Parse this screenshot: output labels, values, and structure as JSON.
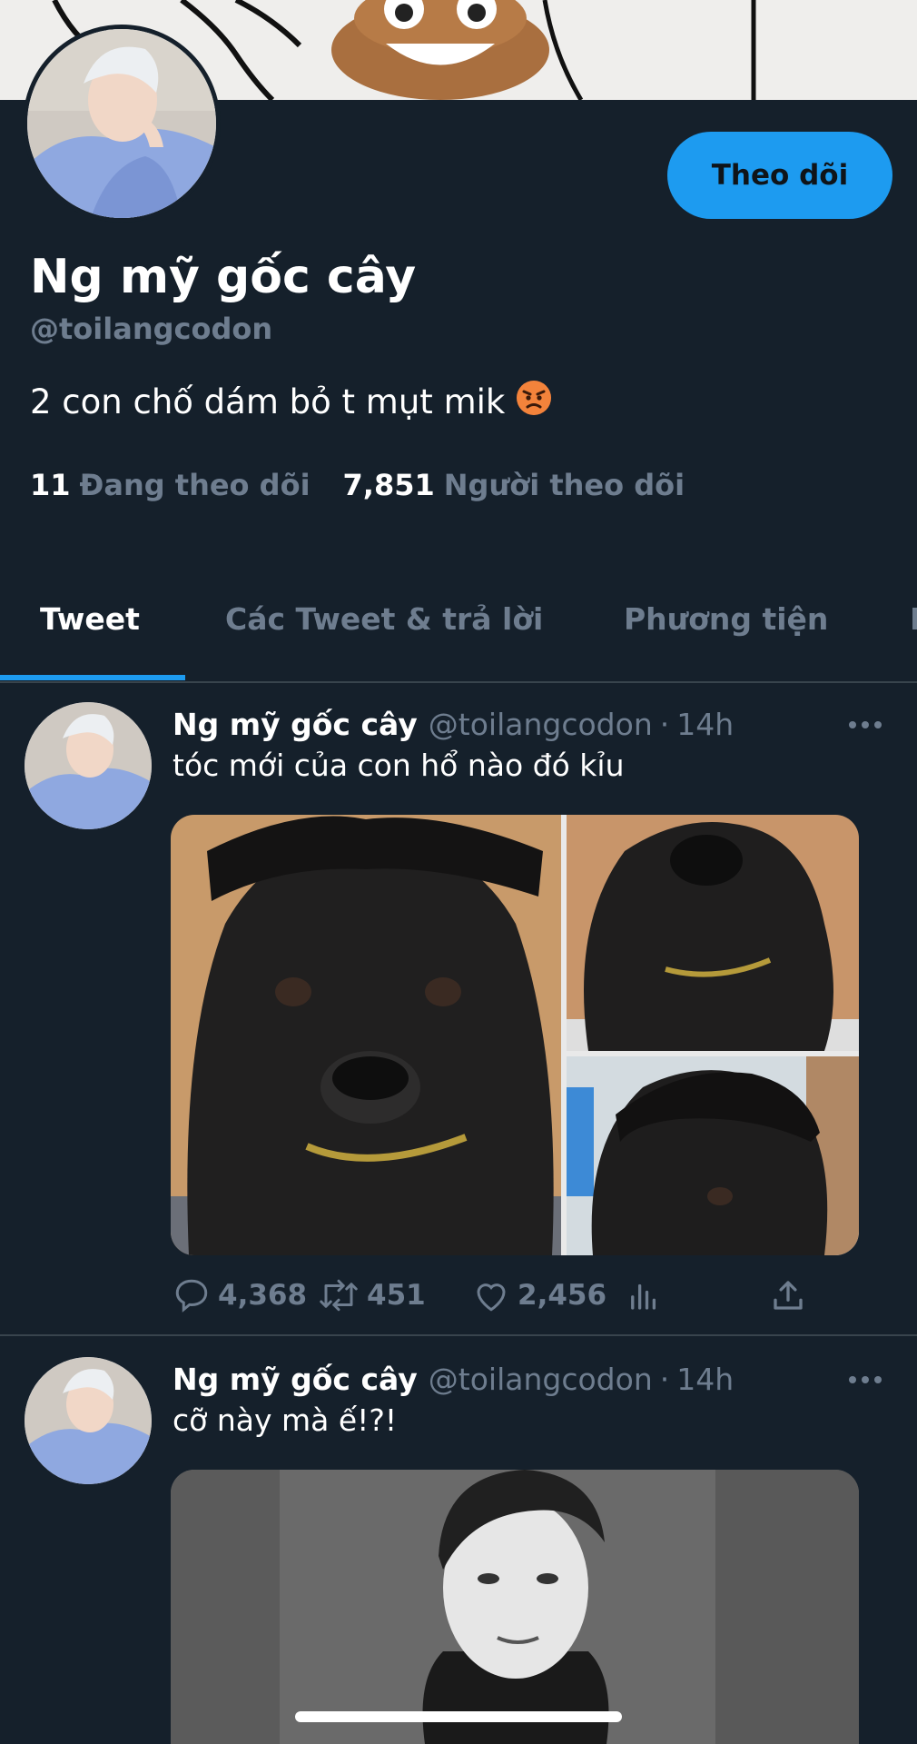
{
  "profile": {
    "display_name": "Ng mỹ gốc cây",
    "handle": "@toilangcodon",
    "bio": "2 con chố dám bỏ t mụt mik",
    "bio_emoji": "angry-face-emoji",
    "follow_button_label": "Theo dõi",
    "following_count": "11",
    "following_label": "Đang theo dõi",
    "followers_count": "7,851",
    "followers_label": "Người theo dõi"
  },
  "tabs": [
    {
      "label": "Tweet",
      "active": true
    },
    {
      "label": "Các Tweet & trả lời",
      "active": false
    },
    {
      "label": "Phương tiện",
      "active": false
    }
  ],
  "tweets": [
    {
      "name": "Ng mỹ gốc cây",
      "handle": "@toilangcodon",
      "separator": "·",
      "time": "14h",
      "text": "tóc mới của con hổ nào đó kỉu",
      "replies": "4,368",
      "retweets": "451",
      "likes": "2,456"
    },
    {
      "name": "Ng mỹ gốc cây",
      "handle": "@toilangcodon",
      "separator": "·",
      "time": "14h",
      "text": "cỡ này mà ế!?!"
    }
  ],
  "colors": {
    "background": "#15202b",
    "accent": "#1d9bf0",
    "secondary_text": "#6e7d8f",
    "divider": "#38444d"
  }
}
